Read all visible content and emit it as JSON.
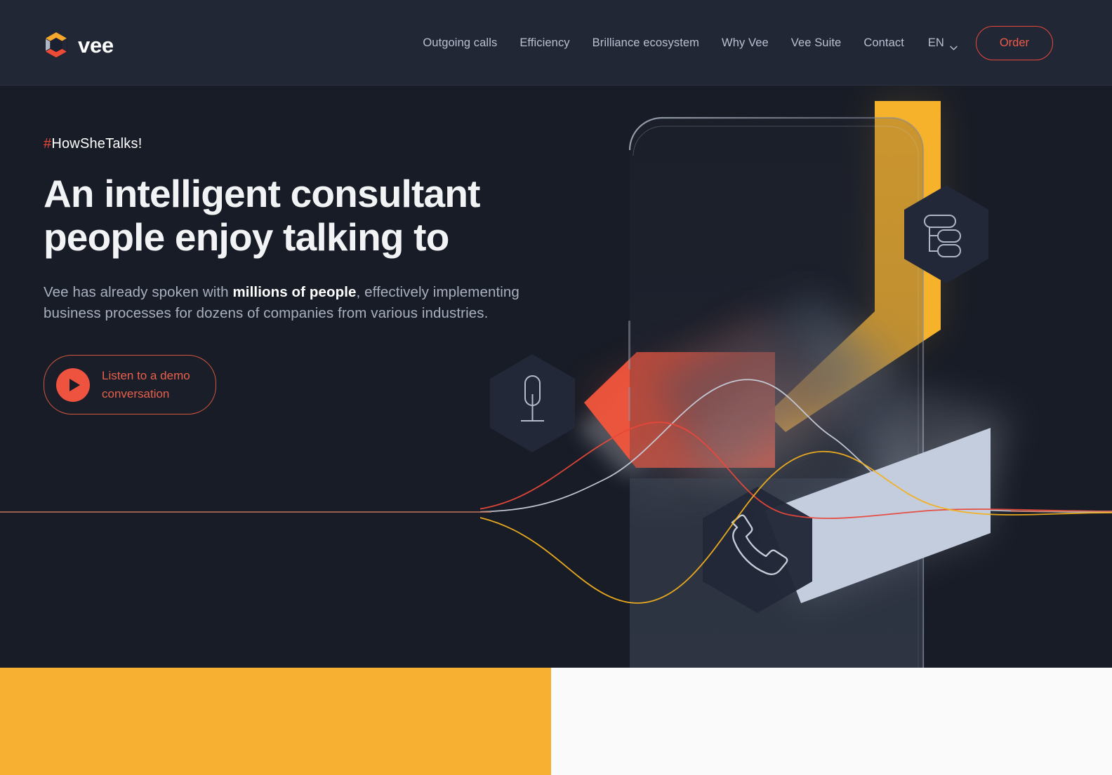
{
  "brand": {
    "name": "vee",
    "logo_icon": "vee-hexagon-logo"
  },
  "nav": {
    "items": [
      {
        "label": "Outgoing calls"
      },
      {
        "label": "Efficiency"
      },
      {
        "label": "Brilliance ecosystem"
      },
      {
        "label": "Why Vee"
      },
      {
        "label": "Vee Suite"
      },
      {
        "label": "Contact"
      }
    ],
    "language": {
      "label": "EN",
      "chevron_icon": "chevron-down-icon"
    },
    "order_button": {
      "label": "Order"
    }
  },
  "hero": {
    "tagline_hash": "#",
    "tagline_text": "HowSheTalks!",
    "headline_line1": "An intelligent consultant",
    "headline_line2": "people enjoy talking to",
    "subcopy_part1": "Vee has already spoken with ",
    "subcopy_strong": "millions of people",
    "subcopy_part2": ", effectively implementing business processes for dozens of companies from various industries.",
    "demo_button": {
      "line1": "Listen to a demo",
      "line2": "conversation",
      "play_icon": "play-icon"
    },
    "art": {
      "phone_label": "smartphone-outline",
      "hex_badges": [
        {
          "icon": "microphone-icon",
          "name": "hexagon-microphone"
        },
        {
          "icon": "hierarchy-flowchart-icon",
          "name": "hexagon-flowchart"
        },
        {
          "icon": "phone-handset-icon",
          "name": "hexagon-phone"
        }
      ],
      "shapes": [
        {
          "name": "yellow-parallelogram",
          "color": "#F7B22C"
        },
        {
          "name": "red-parallelogram",
          "color": "#F2553C"
        },
        {
          "name": "lightblue-parallelogram",
          "color": "#C3CDDE"
        },
        {
          "name": "grey-parallelogram",
          "color": "#8C9099"
        }
      ],
      "waves": [
        {
          "name": "wave-white",
          "color": "#C6CEDB"
        },
        {
          "name": "wave-red",
          "color": "#E8483A"
        },
        {
          "name": "wave-yellow",
          "color": "#F2B01E"
        }
      ]
    }
  },
  "bottom": {
    "yellow_block_color": "#F7B032",
    "panel_color": "#FAFAFA"
  },
  "colors": {
    "background": "#181C26",
    "header": "#222736",
    "accent_red": "#E8483A",
    "accent_yellow": "#F7B032",
    "accent_blue": "#C3CDDE",
    "text_muted": "#A8B0C0"
  }
}
